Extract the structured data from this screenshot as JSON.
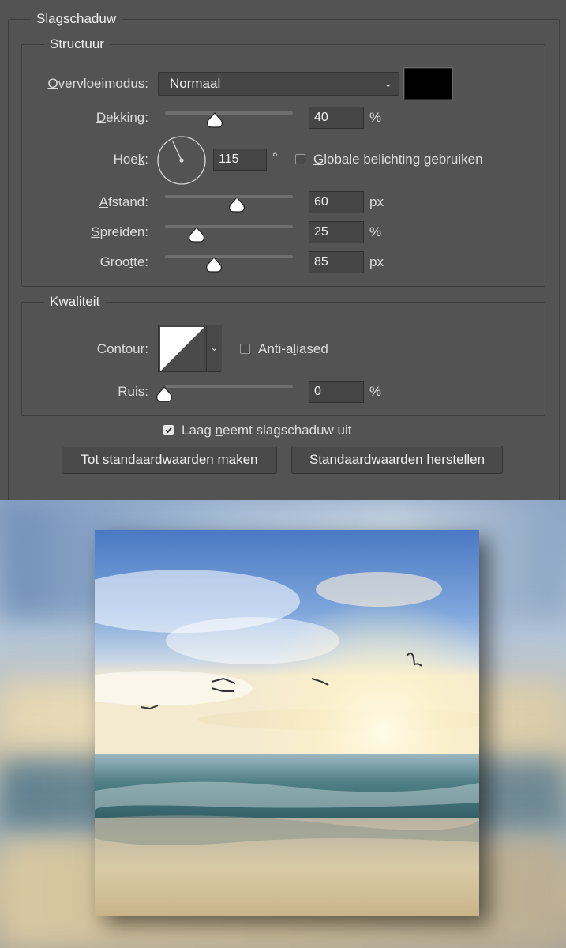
{
  "panel": {
    "title": "Slagschaduw",
    "structure": {
      "legend": "Structuur",
      "blend_mode": {
        "label_prefix": "",
        "label_u": "O",
        "label_rest": "vervloeimodus:",
        "value": "Normaal",
        "color": "#000000"
      },
      "opacity": {
        "label_u": "D",
        "label_rest": "ekking:",
        "value": "40",
        "unit": "%",
        "slider": 0.4
      },
      "angle": {
        "label_pre": "Hoe",
        "label_u": "k",
        "label_rest": ":",
        "value": "115",
        "unit": "°",
        "degrees": 115,
        "global_light": {
          "label_u": "G",
          "label_rest": "lobale belichting gebruiken",
          "checked": false
        }
      },
      "distance": {
        "label_u": "A",
        "label_rest": "fstand:",
        "value": "60",
        "unit": "px",
        "slider": 0.56
      },
      "spread": {
        "label_u": "S",
        "label_rest": "preiden:",
        "value": "25",
        "unit": "%",
        "slider": 0.25
      },
      "size": {
        "label_pre": "Groo",
        "label_u": "t",
        "label_rest": "te:",
        "value": "85",
        "unit": "px",
        "slider": 0.39
      }
    },
    "quality": {
      "legend": "Kwaliteit",
      "contour": {
        "label": "Contour:"
      },
      "anti_aliased": {
        "label_pre": "Anti-a",
        "label_u": "l",
        "label_rest": "iased",
        "checked": false
      },
      "noise": {
        "label_u": "R",
        "label_rest": "uis:",
        "value": "0",
        "unit": "%",
        "slider": 0.0
      }
    },
    "knockout": {
      "label_pre": "Laag ",
      "label_u": "n",
      "label_rest": "eemt slagschaduw uit",
      "checked": true
    },
    "buttons": {
      "make_default": "Tot standaardwaarden maken",
      "reset_default": "Standaardwaarden herstellen"
    }
  }
}
